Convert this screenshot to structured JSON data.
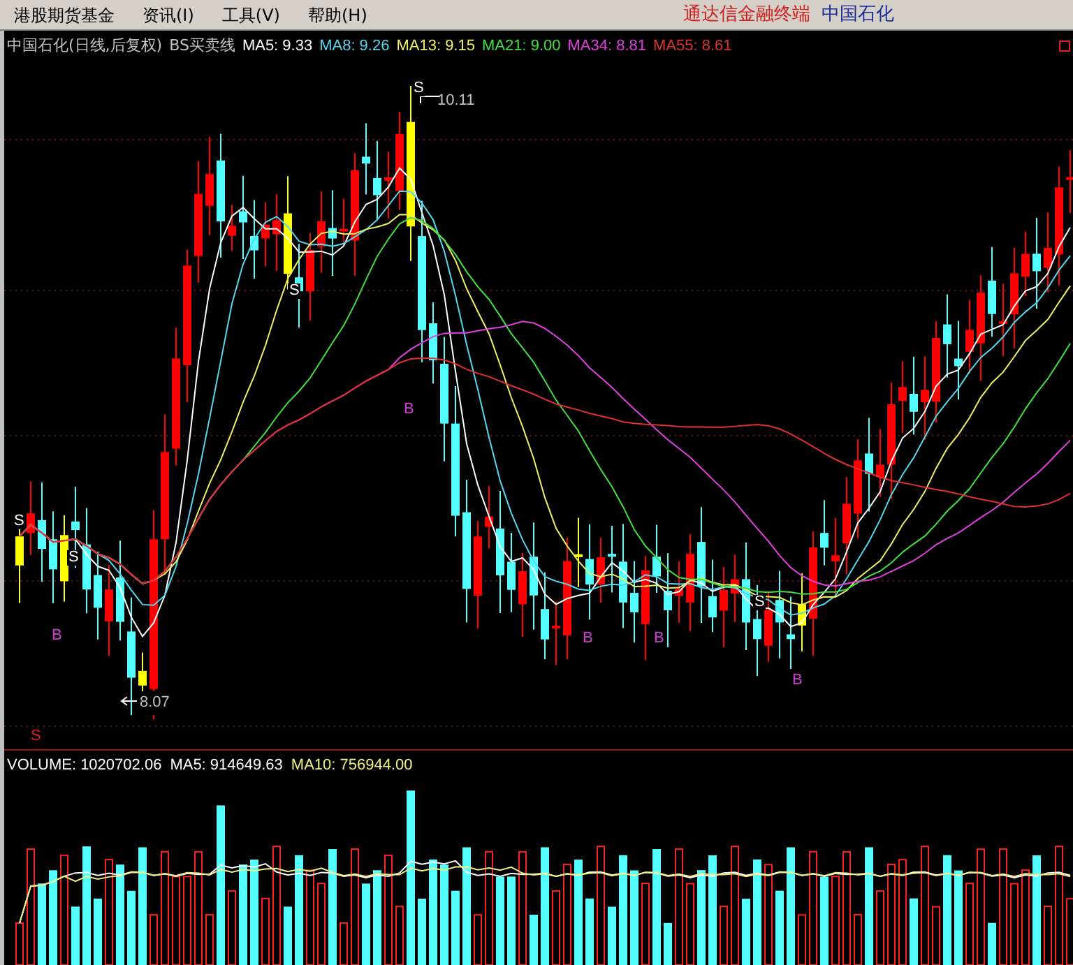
{
  "menu": [
    {
      "label": "港股期货基金"
    },
    {
      "label": "资讯(I)"
    },
    {
      "label": "工具(V)"
    },
    {
      "label": "帮助(H)"
    }
  ],
  "links": [
    "通达信金融终端",
    "中国石化"
  ],
  "chart": {
    "title": "中国石化(日线,后复权)",
    "indicator": "BS买卖线",
    "legend": [
      {
        "label": "MA5: 9.33",
        "color": "#ffffff"
      },
      {
        "label": "MA8: 9.26",
        "color": "#54d8f0"
      },
      {
        "label": "MA13: 9.15",
        "color": "#f0f060"
      },
      {
        "label": "MA21: 9.00",
        "color": "#40e040"
      },
      {
        "label": "MA34: 8.81",
        "color": "#e040e0"
      },
      {
        "label": "MA55: 8.61",
        "color": "#e03030"
      }
    ],
    "high_label": "10.11",
    "low_label": "8.07",
    "signals": [
      {
        "kind": "sell",
        "text": "S"
      },
      {
        "kind": "sell",
        "text": "S"
      },
      {
        "kind": "buy",
        "text": "B"
      },
      {
        "kind": "sell",
        "text": "S"
      },
      {
        "kind": "sell",
        "text": "S"
      },
      {
        "kind": "buy",
        "text": "B"
      },
      {
        "kind": "buy",
        "text": "B"
      },
      {
        "kind": "buy",
        "text": "B"
      },
      {
        "kind": "sell",
        "text": "S"
      },
      {
        "kind": "buy",
        "text": "B"
      },
      {
        "kind": "marker",
        "text": "S"
      }
    ]
  },
  "volume": {
    "legend": [
      {
        "label": "VOLUME: 1020702.06",
        "color": "#ffffff"
      },
      {
        "label": "MA5: 914649.63",
        "color": "#ffffff"
      },
      {
        "label": "MA10: 756944.00",
        "color": "#f0f080"
      }
    ]
  }
}
